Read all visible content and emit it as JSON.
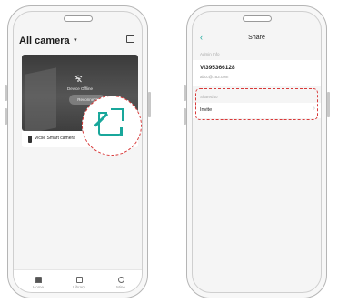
{
  "left_screen": {
    "title": "All camera",
    "title_caret": "▾",
    "message_icon": "message-icon",
    "camera": {
      "status_icon": "wifi-off-icon",
      "status_text": "Device Offline",
      "reconnect_label": "Reconnect",
      "name": "Vicse Smart camera"
    },
    "share_icon": "share-icon",
    "tabs": [
      {
        "label": "Home",
        "icon": "home-icon"
      },
      {
        "label": "Library",
        "icon": "library-icon"
      },
      {
        "label": "Mine",
        "icon": "user-icon"
      }
    ]
  },
  "right_screen": {
    "back_icon": "‹",
    "title": "Share",
    "admin_label": "Admin Info",
    "admin_id": "Vi395366128",
    "admin_email": "abcc@163.com",
    "shared_label": "Shared to",
    "invite_label": "Invite",
    "invite_chevron": "›"
  },
  "colors": {
    "accent": "#19a79b",
    "highlight": "#d93a3a"
  }
}
